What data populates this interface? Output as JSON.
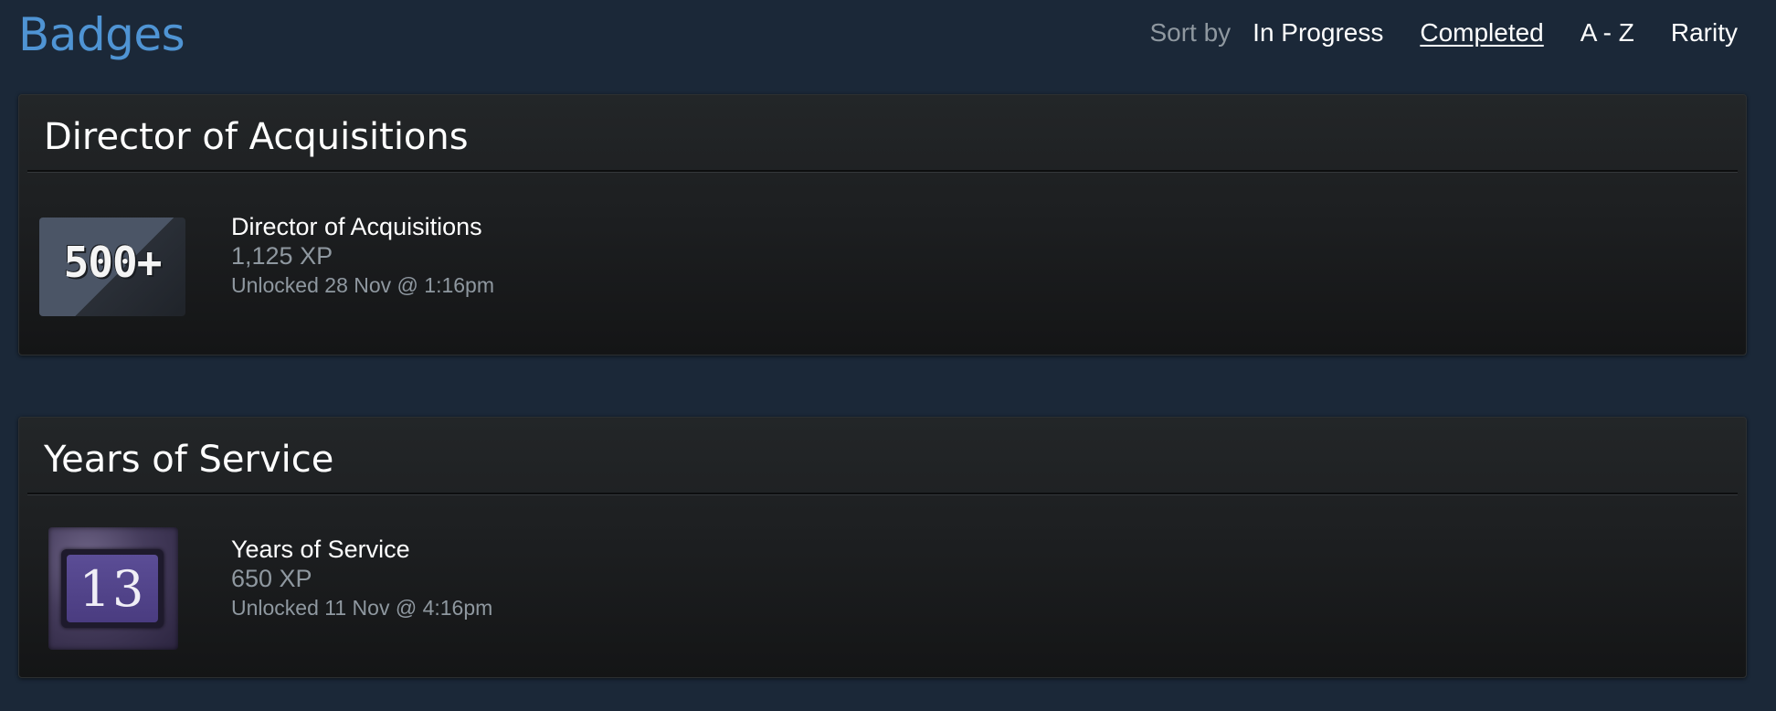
{
  "header": {
    "title": "Badges",
    "sort_label": "Sort by",
    "sort_options": [
      {
        "label": "In Progress",
        "active": false
      },
      {
        "label": "Completed",
        "active": true
      },
      {
        "label": "A - Z",
        "active": false
      },
      {
        "label": "Rarity",
        "active": false
      }
    ]
  },
  "badges": [
    {
      "header": "Director of Acquisitions",
      "icon": "500-plus-badge-icon",
      "icon_text": "500+",
      "name": "Director of Acquisitions",
      "xp": "1,125 XP",
      "unlocked": "Unlocked 28 Nov @ 1:16pm"
    },
    {
      "header": "Years of Service",
      "icon": "years-of-service-badge-icon",
      "icon_text": "13",
      "name": "Years of Service",
      "xp": "650 XP",
      "unlocked": "Unlocked 11 Nov @ 4:16pm"
    }
  ],
  "colors": {
    "background": "#1b2838",
    "title_blue": "#4f94d4",
    "muted_text": "#8f98a0"
  }
}
